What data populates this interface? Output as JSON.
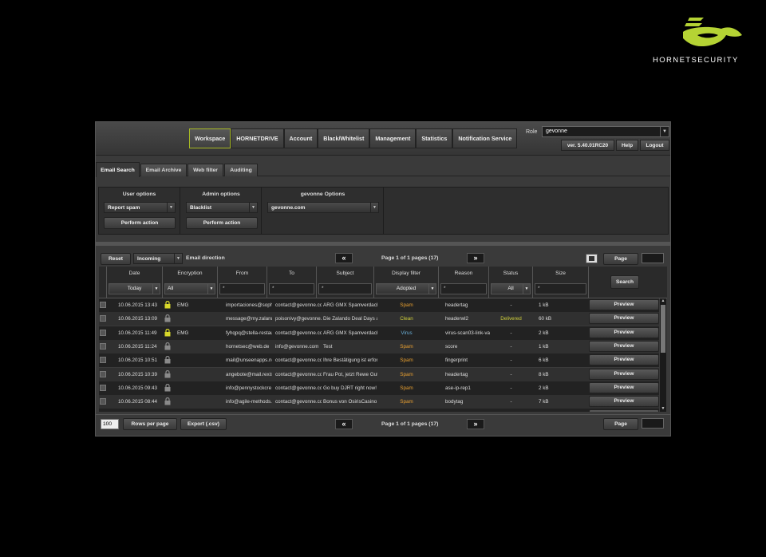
{
  "brand": {
    "name": "HORNETSECURITY",
    "accent": "#b5d334"
  },
  "nav": {
    "tabs": [
      "Workspace",
      "HORNETDRIVE",
      "Account",
      "Black/Whitelist",
      "Management",
      "Statistics",
      "Notification Service"
    ],
    "active": "Workspace"
  },
  "role": {
    "label": "Role",
    "value": "gevonne"
  },
  "version": "ver. 5.40.01RC20",
  "help": "Help",
  "logout": "Logout",
  "subtabs": [
    "Email Search",
    "Email Archive",
    "Web filter",
    "Auditing"
  ],
  "options": {
    "user": {
      "title": "User options",
      "select": "Report spam",
      "action": "Perform action"
    },
    "admin": {
      "title": "Admin options",
      "select": "Blacklist",
      "action": "Perform action"
    },
    "gevonne": {
      "title": "gevonne Options",
      "select": "gevonne.com"
    }
  },
  "toolbar": {
    "reset": "Reset",
    "direction_value": "Incoming",
    "direction_label": "Email direction",
    "pager": "Page 1 of 1 pages (17)",
    "prev": "«",
    "next": "»",
    "page_button": "Page"
  },
  "grid": {
    "headers": [
      "Date",
      "Encryption",
      "From",
      "To",
      "Subject",
      "Display filter",
      "Reason",
      "Status",
      "Size"
    ],
    "filters": {
      "date": "Today",
      "encryption": "All",
      "from": "*",
      "to": "*",
      "subject": "*",
      "display": "Adopted",
      "reason": "*",
      "status": "All",
      "size": "*"
    },
    "search_button": "Search",
    "preview_label": "Preview",
    "rows": [
      {
        "date": "10.06.2015 13:43",
        "enc": "EMG",
        "locked": true,
        "from": "importaciones@soph",
        "to": "contact@gevonne.cc",
        "subject": "ARG GMX Spamverdach",
        "filter": "Spam",
        "reason": "headertag",
        "status": "-",
        "size": "1 kB"
      },
      {
        "date": "10.06.2015 13:09",
        "enc": "",
        "locked": false,
        "from": "message@my.zaland",
        "to": "poisonivy@gevonne.",
        "subject": "Die Zalando Deal Days a",
        "filter": "Clean",
        "reason": "headerwl2",
        "status": "Delivered",
        "size": "60 kB"
      },
      {
        "date": "10.06.2015 11:49",
        "enc": "EMG",
        "locked": true,
        "from": "fyhqpq@stella-restau",
        "to": "contact@gevonne.cc",
        "subject": "ARG GMX Spamverdach",
        "filter": "Virus",
        "reason": "virus-scan03-link-va",
        "status": "-",
        "size": "2 kB"
      },
      {
        "date": "10.06.2015 11:24",
        "enc": "",
        "locked": false,
        "from": "hornetsec@web.de",
        "to": "info@gevonne.com",
        "subject": "Test",
        "filter": "Spam",
        "reason": "score",
        "status": "-",
        "size": "1 kB"
      },
      {
        "date": "10.06.2015 10:51",
        "enc": "",
        "locked": false,
        "from": "mail@unseenapps.ne",
        "to": "contact@gevonne.cc",
        "subject": "Ihre Bestätigung ist erfor",
        "filter": "Spam",
        "reason": "fingerprint",
        "status": "-",
        "size": "6 kB"
      },
      {
        "date": "10.06.2015 10:39",
        "enc": "",
        "locked": false,
        "from": "angebote@mail.rexis",
        "to": "contact@gevonne.cc",
        "subject": "Frau Pot, jetzt Rewe Gut",
        "filter": "Spam",
        "reason": "headertag",
        "status": "-",
        "size": "8 kB"
      },
      {
        "date": "10.06.2015 09:43",
        "enc": "",
        "locked": false,
        "from": "info@pennystockcre",
        "to": "contact@gevonne.cc",
        "subject": "Go buy DJRT right now!",
        "filter": "Spam",
        "reason": "ase-ip-rep1",
        "status": "-",
        "size": "2 kB"
      },
      {
        "date": "10.06.2015 08:44",
        "enc": "",
        "locked": false,
        "from": "info@agile-methods.r",
        "to": "contact@gevonne.cc",
        "subject": "Bonus von OsirisCasino",
        "filter": "Spam",
        "reason": "bodytag",
        "status": "-",
        "size": "7 kB"
      },
      {
        "date": "",
        "enc": "",
        "locked": false,
        "from": "",
        "to": "",
        "subject": "",
        "filter": "",
        "reason": "",
        "status": "",
        "size": ""
      }
    ]
  },
  "footer": {
    "per_page_value": "100",
    "rows_per_page": "Rows per page",
    "export": "Export (.csv)",
    "pager": "Page 1 of 1 pages (17)",
    "page_button": "Page"
  }
}
